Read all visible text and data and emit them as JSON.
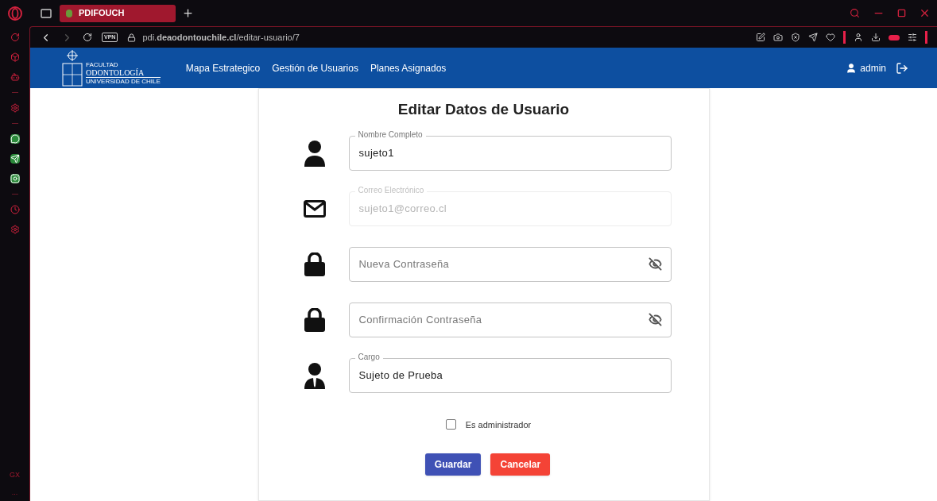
{
  "browser": {
    "tab": {
      "title": "PDIFOUCH",
      "selected": true
    },
    "vpn_badge": "VPN",
    "url": "pdi.**deaodontouchile.cl**/editar-usuario/7",
    "sidebar_footer": [
      "GX",
      "..."
    ]
  },
  "header": {
    "logo": {
      "line1": "FACULTAD",
      "line2": "ODONTOLOGÍA",
      "line3": "UNIVERSIDAD DE CHILE"
    },
    "nav": [
      "Mapa Estrategico",
      "Gestión de Usuarios",
      "Planes Asignados"
    ],
    "user": "admin"
  },
  "form": {
    "title": "Editar Datos de Usuario",
    "fields": [
      {
        "kind": "person",
        "label": "Nombre Completo",
        "value": "sujeto1",
        "disabled": false,
        "password_toggle": false
      },
      {
        "kind": "email",
        "label": "Correo Electrónico",
        "value": "sujeto1@correo.cl",
        "disabled": true,
        "password_toggle": false
      },
      {
        "kind": "lock",
        "placeholder": "Nueva Contraseña",
        "disabled": false,
        "password_toggle": true
      },
      {
        "kind": "lock",
        "placeholder": "Confirmación Contraseña",
        "disabled": false,
        "password_toggle": true
      },
      {
        "kind": "worker",
        "label": "Cargo",
        "value": "Sujeto de Prueba",
        "disabled": false,
        "password_toggle": false
      }
    ],
    "checkbox": {
      "label": "Es administrador",
      "checked": false
    },
    "buttons": [
      {
        "label": "Guardar",
        "kind": "primary"
      },
      {
        "label": "Cancelar",
        "kind": "danger"
      }
    ]
  }
}
